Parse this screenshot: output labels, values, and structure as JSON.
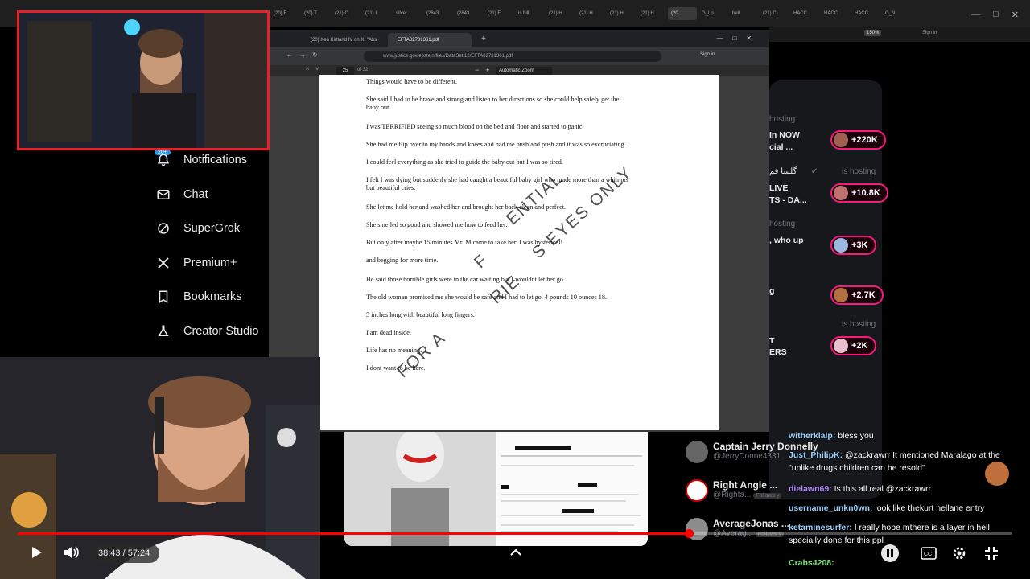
{
  "outer_browser": {
    "tabs": [
      "(20) F",
      "(20) T",
      "(21) C",
      "(21) I",
      "silver",
      "(2843",
      "(2843",
      "(21) F",
      "is bill",
      "(21) H",
      "(21) H",
      "(21) H",
      "(21) H",
      "(20",
      "G_Lo",
      "hell",
      "(21) C",
      "HACC",
      "HACC",
      "HACC",
      "G_N"
    ],
    "zoom": "150%",
    "signin": "Sign in"
  },
  "inner_browser": {
    "tab1": "(20) Ken Kirtland IV on X: \"Abs",
    "tab2": "EFTA02731361.pdf",
    "url": "www.justice.gov/epstein/files/DataSet 12/EFTA02731361.pdf",
    "signin": "Sign in"
  },
  "pdf_toolbar": {
    "page": "25",
    "of": "of 32",
    "zoom": "Automatic Zoom"
  },
  "pdf": {
    "lines": [
      "Things would have to be different.",
      "She said I had to be brave and strong and listen to her directions so she could help safely get the",
      "baby out.",
      "I was TERRIFIED seeing so much blood on the bed and floor and started to panic.",
      "She had me flip over to my hands and knees and had me push and push and it was so excruciating.",
      "I could feel everything as she tried to guide the baby out but I was so tired.",
      "I felt I was dying but suddenly she had caught a beautiful baby girl who made more than a whimper",
      "but beautiful cries.",
      "She let me hold her and washed her and brought her back clean and perfect.",
      "She smelled so good and showed me how to feed her.",
      "But only after maybe 15 minutes Mr. M came to take her. I was hysterical!",
      "and begging for more time.",
      "He said those horrible girls were in the car waiting but I wouldnt let her go.",
      "The old woman promised me she would be safe and I had to let go. 4 pounds 10 ounces 18.",
      "5 inches long with beautiful long fingers.",
      "I am dead inside.",
      "Life has no meaning.",
      "I dont want to be here."
    ],
    "watermark_1": "FOR A",
    "watermark_2": "RIE",
    "watermark_3": "F",
    "watermark_4": "ENTIAL",
    "watermark_5": "S EYES ONLY"
  },
  "x_nav": {
    "badge": "20+",
    "items": [
      "Notifications",
      "Chat",
      "SuperGrok",
      "Premium+",
      "Bookmarks",
      "Creator Studio"
    ]
  },
  "live": {
    "titles": [
      "In NOW",
      "cial ...",
      "LIVE",
      "TS - DA...",
      ", who up",
      "g",
      "T",
      "ERS"
    ],
    "hosting": [
      "hosting",
      "is hosting",
      "hosting",
      "is hosting"
    ],
    "host_name": "گلسا قم",
    "counts": [
      "+220K",
      "+10.8K",
      "+3K",
      "+2.7K",
      "+2K"
    ]
  },
  "follow": [
    {
      "name": "Captain Jerry Donnelly",
      "handle": "@JerryDonne4331"
    },
    {
      "name": "Right Angle ...",
      "handle": "@Righta...",
      "tag": "Follows y"
    },
    {
      "name": "AverageJonas ...",
      "handle": "@Averag...",
      "tag": "Follows y"
    }
  ],
  "chat": [
    {
      "user": "witherklalp:",
      "text": " bless you",
      "color": "#9ad1ff"
    },
    {
      "user": "Just_PhilipK:",
      "text": " @zackrawrr It mentioned Maralago at the \"unlike drugs children can be resold\"",
      "color": "#9ad1ff"
    },
    {
      "user": "dielawn69:",
      "text": " Is this all real @zackrawrr",
      "color": "#b48cff"
    },
    {
      "user": "username_unkn0wn:",
      "text": " look like thekurt hellane entry",
      "color": "#9ad1ff"
    },
    {
      "user": "ketaminesurfer:",
      "text": " I really hope mthere is a layer in hell specially done for this ppl",
      "color": "#9ad1ff"
    },
    {
      "user": "Crabs4208:",
      "text": "",
      "color": "#7be07b"
    }
  ],
  "player": {
    "time": "38:43 / 57:24",
    "progress": 0.675,
    "accent": "#ff0000"
  }
}
